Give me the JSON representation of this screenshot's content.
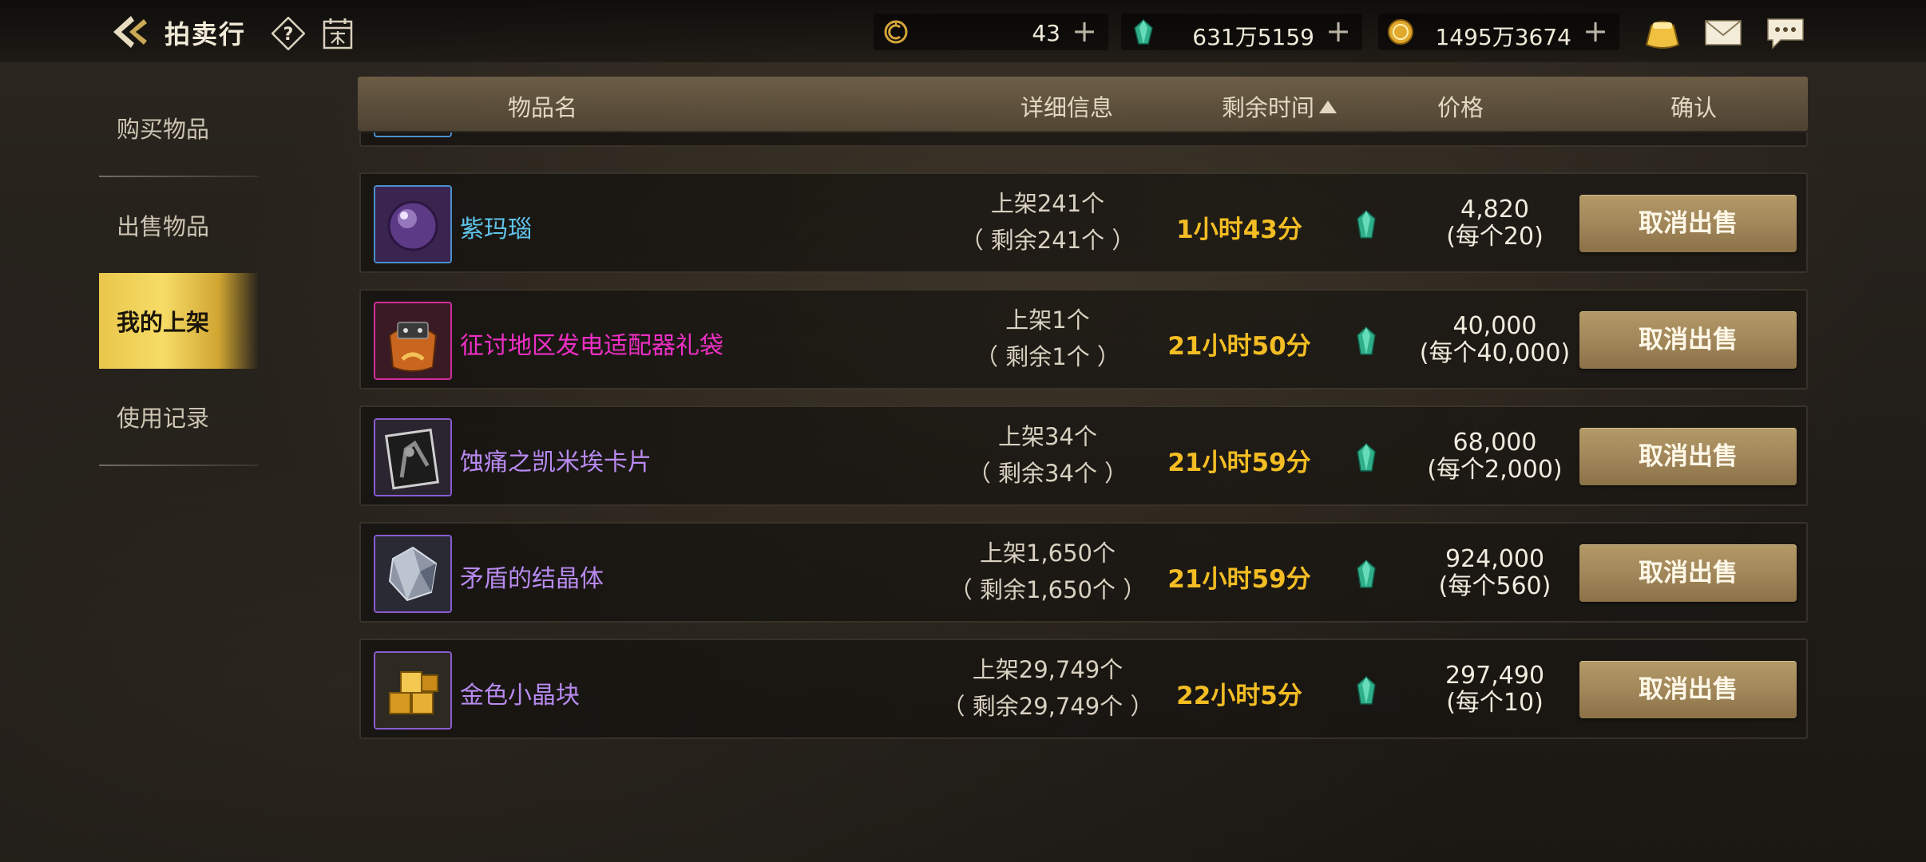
{
  "header": {
    "title": "拍卖行",
    "icons": [
      "back-arrow-icon",
      "help-icon",
      "calendar-icon"
    ]
  },
  "currencies": [
    {
      "name": "c-coin",
      "value": "43",
      "color": "#d4a53c"
    },
    {
      "name": "emerald",
      "value": "631万5159",
      "color": "#3dc39a"
    },
    {
      "name": "gold",
      "value": "1495万3674",
      "color": "#e0a92d"
    }
  ],
  "top_icons": [
    "pouch-icon",
    "mail-icon",
    "chat-icon"
  ],
  "sidebar": {
    "items": [
      {
        "label": "购买物品",
        "active": false
      },
      {
        "label": "出售物品",
        "active": false
      },
      {
        "label": "我的上架",
        "active": true
      },
      {
        "label": "使用记录",
        "active": false
      }
    ]
  },
  "table": {
    "headers": {
      "name": "物品名",
      "detail": "详细信息",
      "time": "剩余时间",
      "price": "价格",
      "confirm": "确认"
    },
    "sort": {
      "column": "time",
      "direction": "ascending"
    },
    "rows": [
      {
        "name": "紫玛瑙",
        "name_color": "#5fc4ea",
        "frame_color": "#4a8fcf",
        "icon": "purple-orb-icon",
        "listed": "上架241个",
        "remaining": "（ 剩余241个 ）",
        "time": "1小时43分",
        "total": "4,820",
        "unit": "(每个20)",
        "action": "取消出售"
      },
      {
        "name": "征讨地区发电适配器礼袋",
        "name_color": "#ee2fc4",
        "frame_color": "#d22e9c",
        "icon": "gift-bag-icon",
        "listed": "上架1个",
        "remaining": "（ 剩余1个 ）",
        "time": "21小时50分",
        "total": "40,000",
        "unit": "(每个40,000)",
        "action": "取消出售"
      },
      {
        "name": "蚀痛之凯米埃卡片",
        "name_color": "#b88af0",
        "frame_color": "#8a5cd2",
        "icon": "card-icon",
        "listed": "上架34个",
        "remaining": "（ 剩余34个 ）",
        "time": "21小时59分",
        "total": "68,000",
        "unit": "(每个2,000)",
        "action": "取消出售"
      },
      {
        "name": "矛盾的结晶体",
        "name_color": "#b88af0",
        "frame_color": "#8a5cd2",
        "icon": "crystal-icon",
        "listed": "上架1,650个",
        "remaining": "（ 剩余1,650个 ）",
        "time": "21小时59分",
        "total": "924,000",
        "unit": "(每个560)",
        "action": "取消出售"
      },
      {
        "name": "金色小晶块",
        "name_color": "#b88af0",
        "frame_color": "#8a5cd2",
        "icon": "gold-cubes-icon",
        "listed": "上架29,749个",
        "remaining": "（ 剩余29,749个 ）",
        "time": "22小时5分",
        "total": "297,490",
        "unit": "(每个10)",
        "action": "取消出售"
      }
    ]
  }
}
